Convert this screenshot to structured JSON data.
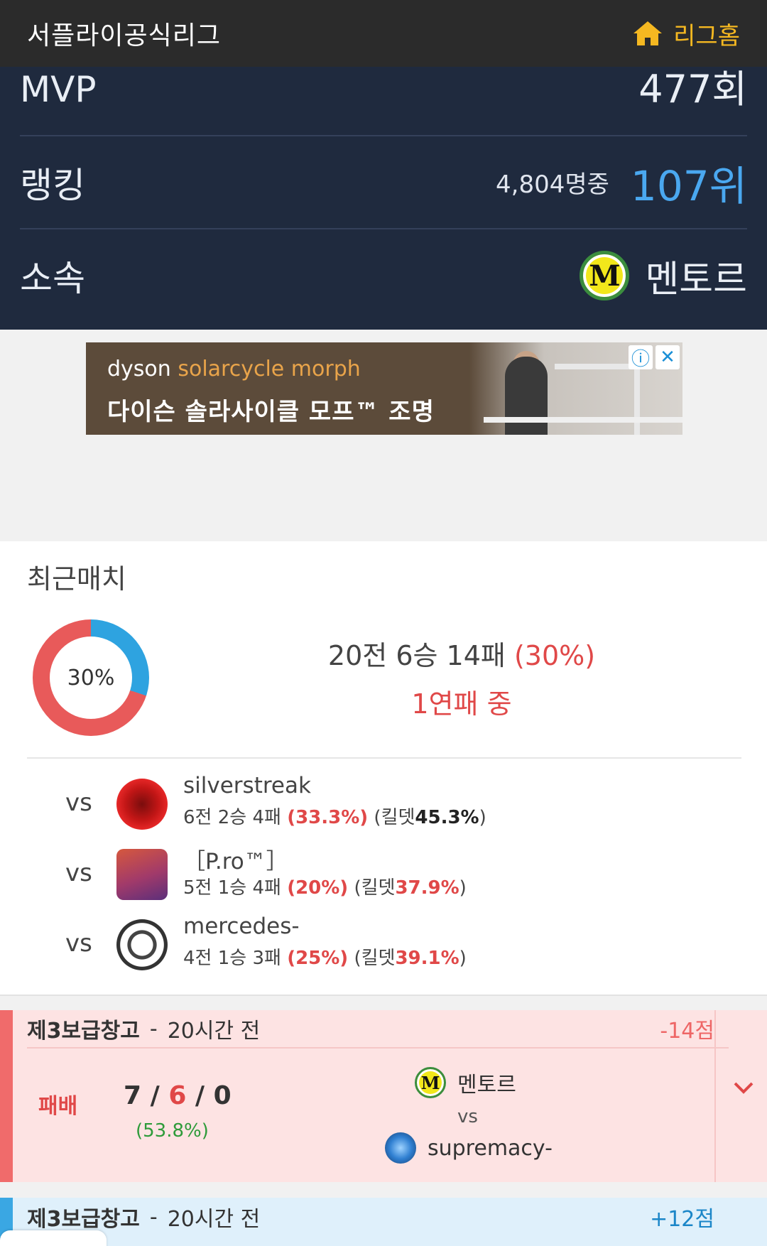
{
  "header": {
    "title": "서플라이공식리그",
    "home_label": "리그홈",
    "home_icon": "home-icon"
  },
  "stats": {
    "mvp": {
      "label": "MVP",
      "value": "477회"
    },
    "ranking": {
      "label": "랭킹",
      "sub": "4,804명중",
      "value": "107위"
    },
    "affiliation": {
      "label": "소속",
      "name": "멘토르",
      "logo_letter": "M"
    }
  },
  "ad": {
    "brand": "dyson",
    "product": "solarcycle morph",
    "headline": "다이슨 솔라사이클 모프™ 조명",
    "info_icon": "info-icon",
    "close_icon": "close-icon"
  },
  "recent": {
    "title": "최근매치",
    "donut_label": "30%",
    "win_fraction": 0.3,
    "record_text": "20전 6승 14패",
    "record_pct": "(30%)",
    "streak": "1연패 중",
    "colors": {
      "loss": "#e85a5a",
      "win": "#2ea3e0"
    },
    "opponents": [
      {
        "vs": "vs",
        "name": "silverstreak",
        "record": "6전 2승 4패",
        "winrate": "(33.3%)",
        "kd_label": "(킬뎃",
        "kd": "45.3%",
        "kd_end": ")"
      },
      {
        "vs": "vs",
        "name": "［P.ro™］",
        "record": "5전 1승 4패",
        "winrate": "(20%)",
        "kd_label": "(킬뎃",
        "kd": "37.9%",
        "kd_end": ")"
      },
      {
        "vs": "vs",
        "name": "mercedes-",
        "record": "4전 1승 3패",
        "winrate": "(25%)",
        "kd_label": "(킬뎃",
        "kd": "39.1%",
        "kd_end": ")"
      }
    ]
  },
  "matches": [
    {
      "map": "제3보급창고",
      "sep": "-",
      "time": "20시간 전",
      "points": "-14점",
      "result": "패배",
      "kills": "7",
      "deaths": "6",
      "assists": "0",
      "slash": "/",
      "kp": "(53.8%)",
      "team_a": "멘토르",
      "team_a_letter": "M",
      "vs": "vs",
      "team_b": "supremacy-"
    },
    {
      "map": "제3보급창고",
      "sep": "-",
      "time": "20시간 전",
      "points": "+12점"
    }
  ]
}
